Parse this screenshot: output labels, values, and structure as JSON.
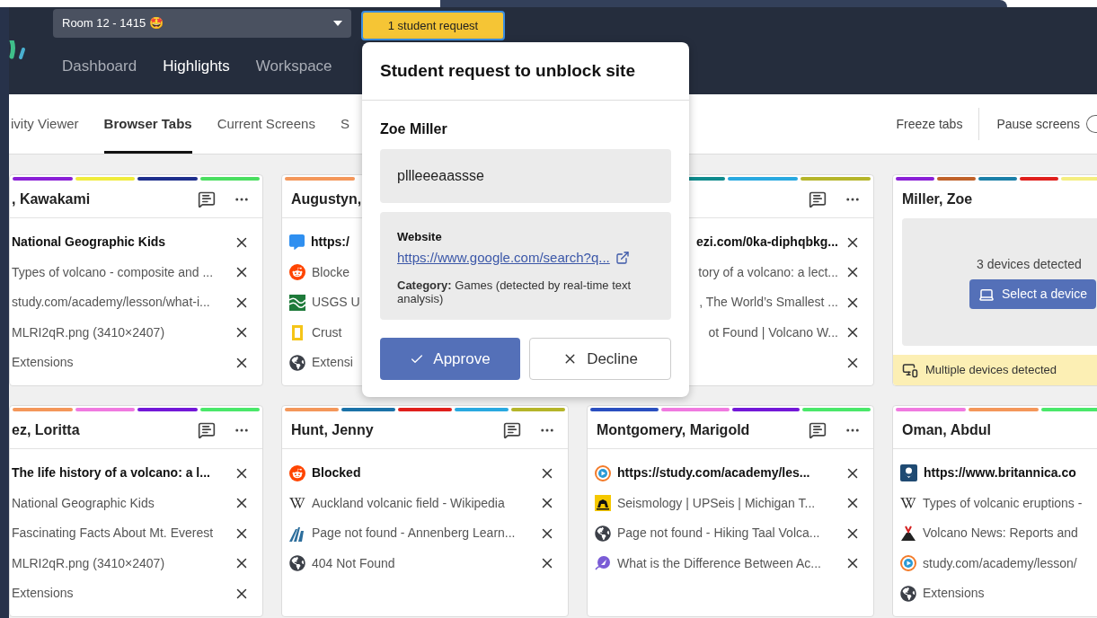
{
  "room_selector": {
    "value": "Room 12 - 1415 🤩"
  },
  "request_button": {
    "label": "1 student request"
  },
  "nav": [
    {
      "label": "Dashboard",
      "selected": false
    },
    {
      "label": "Highlights",
      "selected": true
    },
    {
      "label": "Workspace",
      "selected": false
    }
  ],
  "view_tabs": [
    {
      "label": "ivity Viewer",
      "selected": false
    },
    {
      "label": "Browser Tabs",
      "selected": true
    },
    {
      "label": "Current Screens",
      "selected": false
    },
    {
      "label": "S",
      "selected": false
    }
  ],
  "toolbar": {
    "freeze": "Freeze tabs",
    "pause": "Pause screens",
    "pause_on": false
  },
  "card_rows": [
    [
      {
        "kind": "tabs",
        "name": ", Kawakami",
        "bars": [
          {
            "color": "#8a1fd6"
          },
          {
            "color": "#f0ec3c"
          },
          {
            "color": "#1e2f8c"
          },
          {
            "color": "#4ade60"
          }
        ],
        "actions": true,
        "closable": true,
        "items": [
          {
            "title": "National Geographic Kids",
            "active": true
          },
          {
            "title": "Types of volcano - composite and ...",
            "active": false
          },
          {
            "title": "study.com/academy/lesson/what-i...",
            "active": false
          },
          {
            "title": "MLRI2qR.png (3410×2407)",
            "active": false
          },
          {
            "title": "Extensions",
            "active": false
          }
        ]
      },
      {
        "kind": "tabs",
        "name": "Augustyn,",
        "bars": [
          {
            "color": "#f4975a"
          }
        ],
        "actions": false,
        "closable": false,
        "items": [
          {
            "title": "https:/",
            "active": true
          },
          {
            "title": "Blocke",
            "active": false
          },
          {
            "title": "USGS U",
            "active": false
          },
          {
            "title": "Crust",
            "active": false
          },
          {
            "title": "Extensi",
            "active": false
          }
        ]
      },
      {
        "kind": "tabs",
        "bars": [
          {
            "color": "#0f8b8d"
          },
          {
            "color": "#29a9e0"
          },
          {
            "color": "#b5b52a"
          }
        ],
        "actions": true,
        "closable": true,
        "items": [
          {
            "title": "ezi.com/0ka-diphqbkg...",
            "active": true
          },
          {
            "title": "tory of a volcano: a lect...",
            "active": false
          },
          {
            "title": ", The World’s Smallest ...",
            "active": false
          },
          {
            "title": "ot Found | Volcano W...",
            "active": false
          }
        ]
      },
      {
        "kind": "devices",
        "name": "Miller, Zoe",
        "bars": [
          {
            "color": "#8a1fd6"
          },
          {
            "color": "#c0622a"
          },
          {
            "color": "#1b7fa8"
          },
          {
            "color": "#e0201c"
          },
          {
            "color": "#f5ee80"
          }
        ],
        "message": "3 devices detected",
        "button": "Select a device",
        "warning": "Multiple devices detected"
      }
    ],
    [
      {
        "kind": "tabs",
        "name": "ez, Loritta",
        "bars": [
          {
            "color": "#f4975a"
          },
          {
            "color": "#f07ae0"
          },
          {
            "color": "#7318d8"
          },
          {
            "color": "#4ae86a"
          }
        ],
        "actions": true,
        "closable": true,
        "items": [
          {
            "title": "The life history of a volcano: a l...",
            "active": true
          },
          {
            "title": "National Geographic Kids",
            "active": false
          },
          {
            "title": "Fascinating Facts About Mt. Everest",
            "active": false
          },
          {
            "title": "MLRI2qR.png (3410×2407)",
            "active": false
          },
          {
            "title": "Extensions",
            "active": false
          }
        ]
      },
      {
        "kind": "tabs",
        "name": "Hunt, Jenny",
        "bars": [
          {
            "color": "#f4975a"
          },
          {
            "color": "#1b72a8"
          },
          {
            "color": "#e0201c"
          },
          {
            "color": "#29a9e0"
          },
          {
            "color": "#b5b52a"
          }
        ],
        "actions": true,
        "closable": true,
        "items": [
          {
            "title": "Blocked",
            "active": true
          },
          {
            "title": "Auckland volcanic field - Wikipedia",
            "active": false
          },
          {
            "title": "Page not found - Annenberg Learn...",
            "active": false
          },
          {
            "title": "404 Not Found",
            "active": false
          }
        ]
      },
      {
        "kind": "tabs",
        "name": "Montgomery, Marigold",
        "bars": [
          {
            "color": "#2a4fc0"
          },
          {
            "color": "#f07ae0"
          },
          {
            "color": "#7318d8"
          },
          {
            "color": "#4ae86a"
          }
        ],
        "actions": true,
        "closable": true,
        "items": [
          {
            "title": "https://study.com/academy/les...",
            "active": true
          },
          {
            "title": "Seismology | UPSeis | Michigan T...",
            "active": false
          },
          {
            "title": "Page not found - Hiking Taal Volca...",
            "active": false
          },
          {
            "title": "What is the Difference Between Ac...",
            "active": false
          }
        ]
      },
      {
        "kind": "tabs",
        "name": "Oman, Abdul",
        "bars": [
          {
            "color": "#f07ae0"
          },
          {
            "color": "#f4975a"
          },
          {
            "color": "#4ae86a"
          }
        ],
        "actions": false,
        "closable": false,
        "items": [
          {
            "title": "https://www.britannica.co",
            "active": true
          },
          {
            "title": "Types of volcanic eruptions -",
            "active": false
          },
          {
            "title": "Volcano News: Reports and",
            "active": false
          },
          {
            "title": "study.com/academy/lesson/",
            "active": false
          },
          {
            "title": "Extensions",
            "active": false
          }
        ]
      }
    ]
  ],
  "popover": {
    "title": "Student request to unblock site",
    "student": "Zoe Miller",
    "message": "pllleeeaassse",
    "website_label": "Website",
    "website_url": "https://www.google.com/search?q...",
    "category": "**Category:** Games (detected by real-time text analysis)",
    "approve": "Approve",
    "decline": "Decline"
  }
}
